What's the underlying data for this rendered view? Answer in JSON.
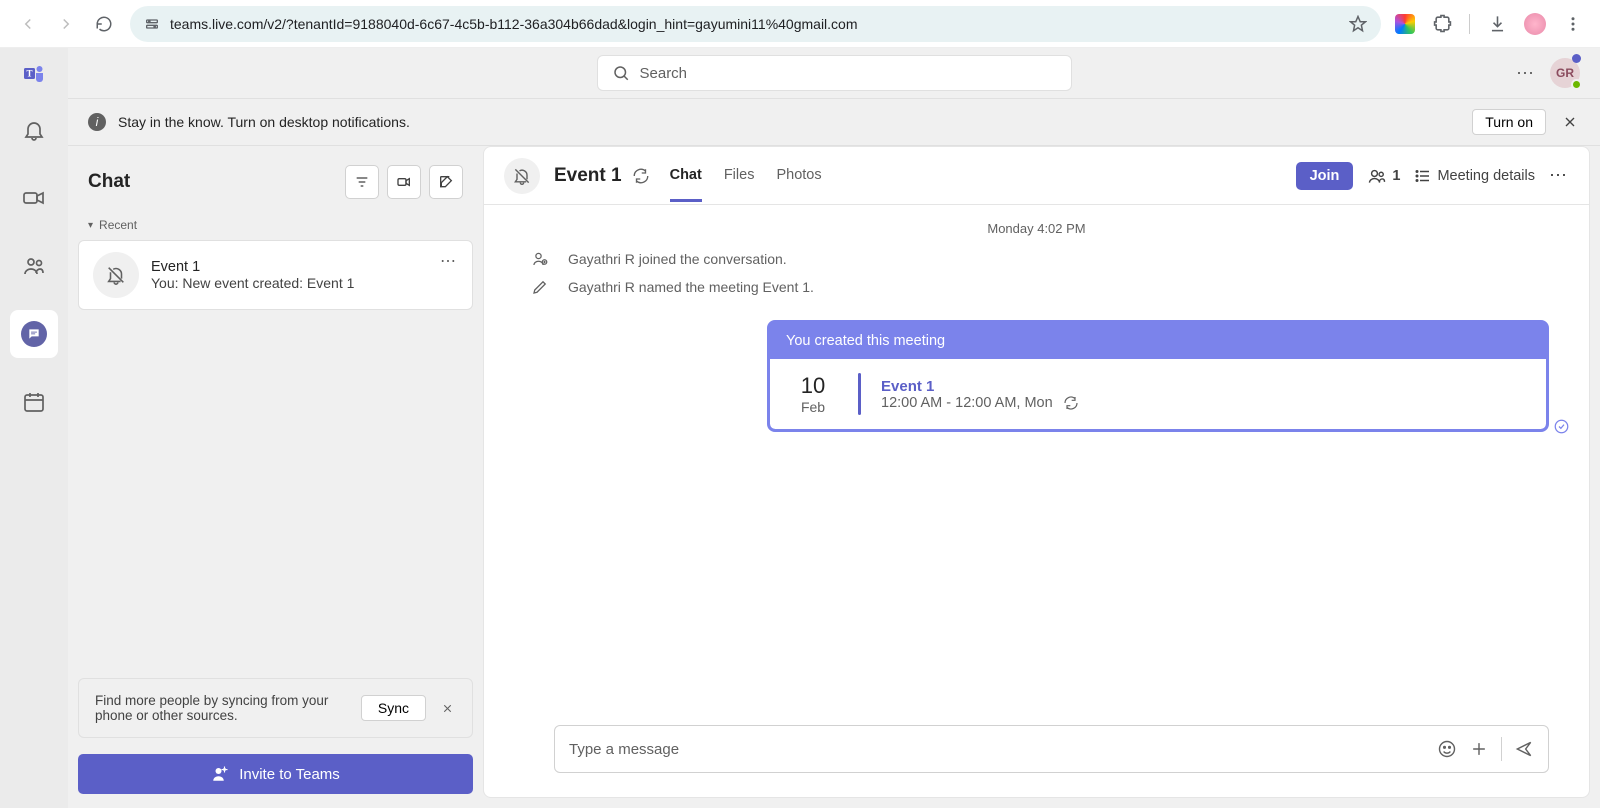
{
  "browser": {
    "url": "teams.live.com/v2/?tenantId=9188040d-6c67-4c5b-b112-36a304b66dad&login_hint=gayumini11%40gmail.com"
  },
  "search": {
    "placeholder": "Search"
  },
  "banner": {
    "text": "Stay in the know. Turn on desktop notifications.",
    "turn_on": "Turn on"
  },
  "header_right": {
    "avatar_initials": "GR"
  },
  "chat_panel": {
    "title": "Chat",
    "recent_label": "Recent",
    "item": {
      "line1": "Event 1",
      "line2": "You: New event created: Event 1"
    },
    "sync": {
      "msg": "Find more people by syncing from your phone or other sources.",
      "btn": "Sync"
    },
    "invite": "Invite to Teams"
  },
  "conv": {
    "title": "Event 1",
    "tabs": {
      "chat": "Chat",
      "files": "Files",
      "photos": "Photos"
    },
    "join": "Join",
    "participants": "1",
    "meeting_details": "Meeting details",
    "timestamp": "Monday 4:02 PM",
    "sys1": "Gayathri R joined the conversation.",
    "sys2": "Gayathri R named the meeting Event 1.",
    "card": {
      "hdr": "You created this meeting",
      "day": "10",
      "mon": "Feb",
      "title": "Event 1",
      "time": "12:00 AM - 12:00 AM, Mon"
    },
    "compose_placeholder": "Type a message"
  }
}
